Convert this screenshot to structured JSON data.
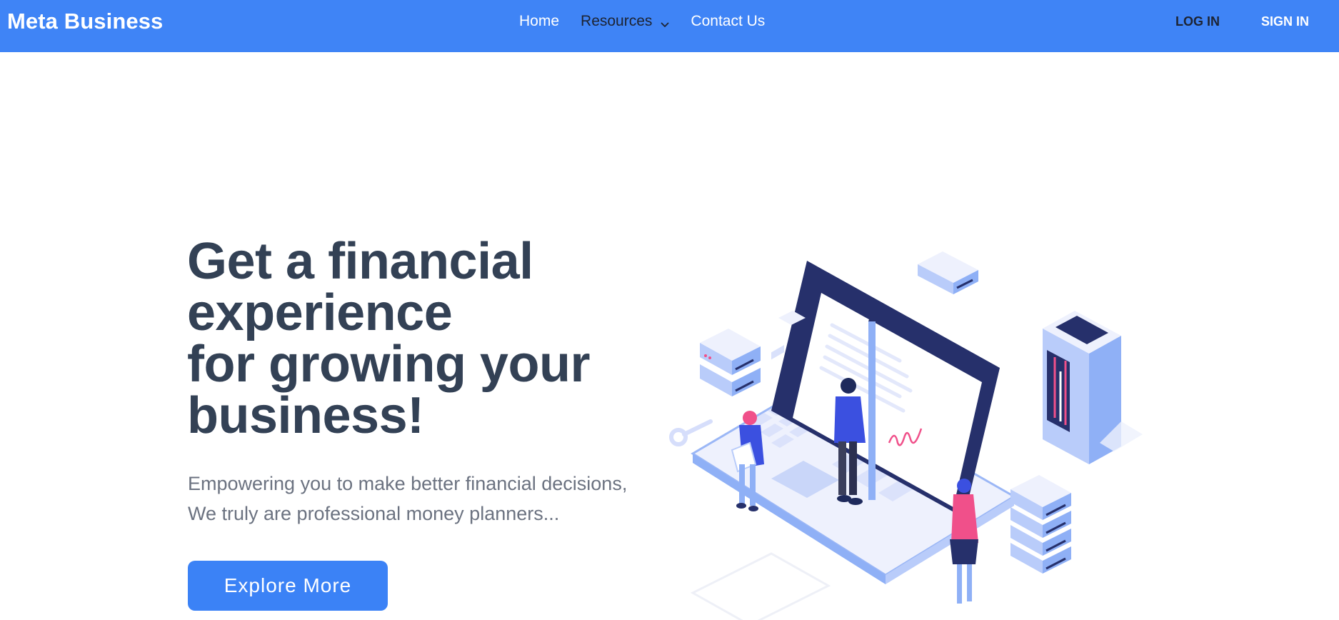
{
  "header": {
    "brand": "Meta Business",
    "nav": {
      "home": "Home",
      "resources": "Resources",
      "contact": "Contact Us"
    },
    "auth": {
      "login": "LOG IN",
      "signin": "SIGN IN"
    }
  },
  "hero": {
    "title_lines": [
      "Get a financial",
      "experience",
      "for growing your",
      "business!"
    ],
    "subtitle_lines": [
      "Empowering you to make better financial decisions,",
      "We truly are professional money planners..."
    ],
    "cta": "Explore More"
  },
  "colors": {
    "nav_bg": "#3f84f6",
    "accent": "#3b82f6",
    "heading": "#334155",
    "subtext": "#6b7280",
    "illustration_navy": "#26306b",
    "illustration_blue": "#8fb0f6",
    "illustration_pink": "#f0508a"
  },
  "icons": {
    "resources_dropdown": "chevron-down-icon"
  }
}
